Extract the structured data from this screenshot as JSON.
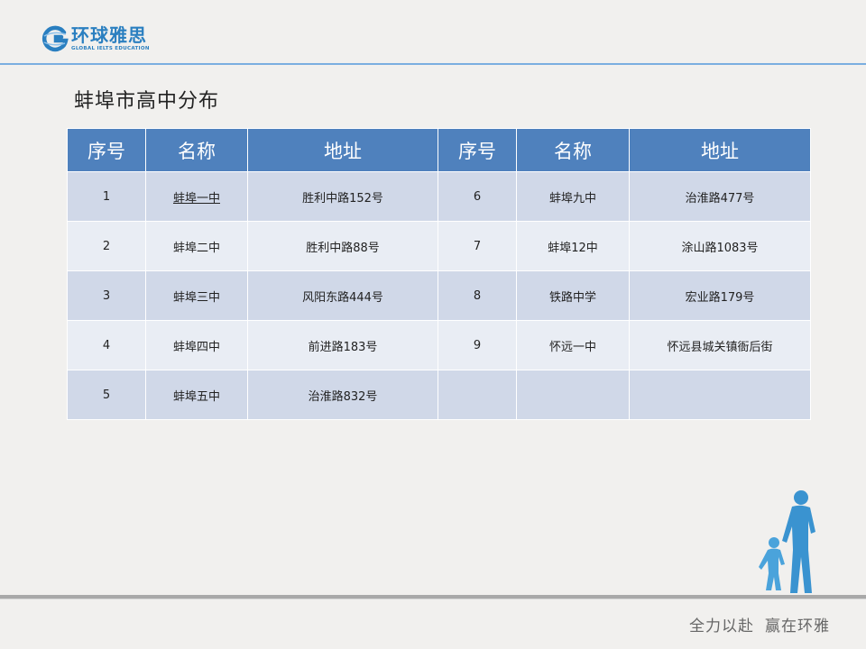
{
  "brand": {
    "name_cn": "环球雅思",
    "name_en": "GLOBAL IELTS EDUCATION",
    "accent": "#2a7fc0"
  },
  "page": {
    "title": "蚌埠市高中分布"
  },
  "table": {
    "header_color": "#4f81bd",
    "row_color_odd": "#d0d8e8",
    "row_color_even": "#e9edf4",
    "headers": [
      "序号",
      "名称",
      "地址",
      "序号",
      "名称",
      "地址"
    ],
    "rows": [
      [
        "1",
        "蚌埠一中",
        "胜利中路152号",
        "6",
        "蚌埠九中",
        "治淮路477号"
      ],
      [
        "2",
        "蚌埠二中",
        "胜利中路88号",
        "7",
        "蚌埠12中",
        "涂山路1083号"
      ],
      [
        "3",
        "蚌埠三中",
        "风阳东路444号",
        "8",
        "铁路中学",
        "宏业路179号"
      ],
      [
        "4",
        "蚌埠四中",
        "前进路183号",
        "9",
        "怀远一中",
        "怀远县城关镇衙后街"
      ],
      [
        "5",
        "蚌埠五中",
        "治淮路832号",
        "",
        "",
        ""
      ]
    ]
  },
  "footer": {
    "slogan_1": "全力以赴",
    "slogan_2": "赢在环雅"
  },
  "decoration": {
    "figure": "adult-and-child-silhouette"
  }
}
